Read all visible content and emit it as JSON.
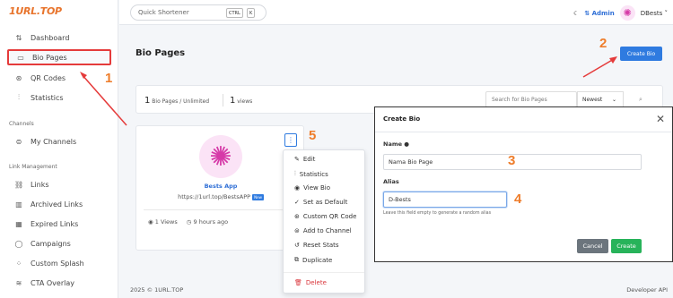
{
  "logo": "1URL.TOP",
  "sidebar": {
    "items": [
      {
        "label": "Dashboard",
        "icon": "dashboard-icon",
        "glyph": "⇅"
      },
      {
        "label": "Bio Pages",
        "icon": "bio-pages-icon",
        "glyph": "▭"
      },
      {
        "label": "QR Codes",
        "icon": "qr-code-icon",
        "glyph": "⊛"
      },
      {
        "label": "Statistics",
        "icon": "statistics-icon",
        "glyph": "⫶"
      }
    ],
    "channels_heading": "Channels",
    "channels_items": [
      {
        "label": "My Channels",
        "icon": "channels-icon",
        "glyph": "⊜"
      }
    ],
    "link_heading": "Link Management",
    "link_items": [
      {
        "label": "Links",
        "icon": "link-icon",
        "glyph": "⛓"
      },
      {
        "label": "Archived Links",
        "icon": "archive-icon",
        "glyph": "▥"
      },
      {
        "label": "Expired Links",
        "icon": "calendar-icon",
        "glyph": "▦"
      },
      {
        "label": "Campaigns",
        "icon": "campaign-icon",
        "glyph": "◯"
      },
      {
        "label": "Custom Splash",
        "icon": "splash-icon",
        "glyph": "⁘"
      },
      {
        "label": "CTA Overlay",
        "icon": "overlay-icon",
        "glyph": "≋"
      }
    ]
  },
  "topbar": {
    "search_placeholder": "Quick Shortener",
    "kbd1": "CTRL",
    "kbd2": "K",
    "theme_icon": "☾",
    "admin_label": "Admin",
    "user_name": "DBests"
  },
  "main": {
    "title": "Bio Pages",
    "create_button": "Create Bio",
    "stats": {
      "count": "1",
      "count_label": "Bio Pages / Unlimited",
      "views": "1",
      "views_label": "views"
    },
    "search_placeholder": "Search for Bio Pages",
    "sort_value": "Newest"
  },
  "bio_card": {
    "name": "Bests App",
    "url": "https://1url.top/BestsAPP",
    "badge": "New",
    "views": "1 Views",
    "time": "9 hours ago"
  },
  "dropdown": {
    "items": [
      {
        "label": "Edit",
        "glyph": "✎"
      },
      {
        "label": "Statistics",
        "glyph": "⫶"
      },
      {
        "label": "View Bio",
        "glyph": "◉"
      },
      {
        "label": "Set as Default",
        "glyph": "✓"
      },
      {
        "label": "Custom QR Code",
        "glyph": "⊛"
      },
      {
        "label": "Add to Channel",
        "glyph": "⊜"
      },
      {
        "label": "Reset Stats",
        "glyph": "↺"
      },
      {
        "label": "Duplicate",
        "glyph": "⧉"
      }
    ],
    "delete_label": "Delete",
    "delete_glyph": "🗑"
  },
  "modal": {
    "title": "Create Bio",
    "name_label": "Name",
    "name_placeholder": "Nama Bio Page",
    "alias_label": "Alias",
    "alias_value": "D-Bests",
    "alias_hint": "Leave this field empty to generate a random alias",
    "cancel_label": "Cancel",
    "submit_label": "Create"
  },
  "footer": {
    "left": "2025 © 1URL.TOP",
    "right": "Developer API"
  },
  "annotations": [
    "1",
    "2",
    "3",
    "4",
    "5"
  ],
  "colors": {
    "accent": "#2f7be0",
    "annotation": "#ee7d2b",
    "highlight": "#e53b3b",
    "success": "#27b35a"
  }
}
